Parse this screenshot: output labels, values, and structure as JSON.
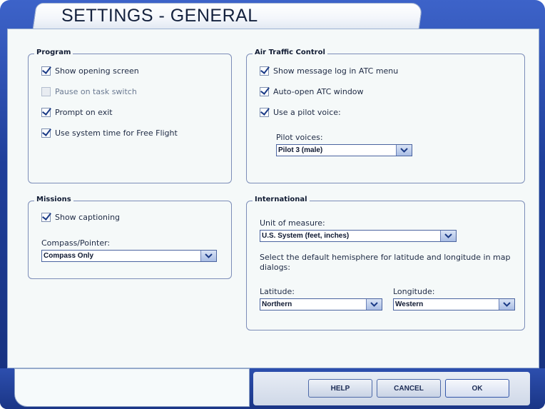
{
  "window": {
    "title": "SETTINGS - GENERAL"
  },
  "program": {
    "title": "Program",
    "items": [
      {
        "label": "Show opening screen",
        "checked": true,
        "enabled": true
      },
      {
        "label": "Pause on task switch",
        "checked": false,
        "enabled": true
      },
      {
        "label": "Prompt on exit",
        "checked": true,
        "enabled": true
      },
      {
        "label": "Use system time for Free Flight",
        "checked": true,
        "enabled": true
      }
    ]
  },
  "atc": {
    "title": "Air Traffic Control",
    "items": [
      {
        "label": "Show message log in ATC menu",
        "checked": true
      },
      {
        "label": "Auto-open ATC window",
        "checked": true
      },
      {
        "label": "Use a pilot voice:",
        "checked": true
      }
    ],
    "pilot_voices_label": "Pilot voices:",
    "pilot_voices_value": "Pilot 3 (male)"
  },
  "missions": {
    "title": "Missions",
    "show_captioning": {
      "label": "Show captioning",
      "checked": true
    },
    "compass_label": "Compass/Pointer:",
    "compass_value": "Compass Only"
  },
  "international": {
    "title": "International",
    "unit_label": "Unit of measure:",
    "unit_value": "U.S. System (feet, inches)",
    "hemisphere_text": "Select the default hemisphere for latitude and longitude in map dialogs:",
    "latitude_label": "Latitude:",
    "latitude_value": "Northern",
    "longitude_label": "Longitude:",
    "longitude_value": "Western"
  },
  "buttons": {
    "help": "HELP",
    "cancel": "CANCEL",
    "ok": "OK"
  },
  "colors": {
    "frame_blue": "#1f3f9a",
    "panel_bg": "#f5f9f9",
    "check_color": "#1a3a86"
  }
}
